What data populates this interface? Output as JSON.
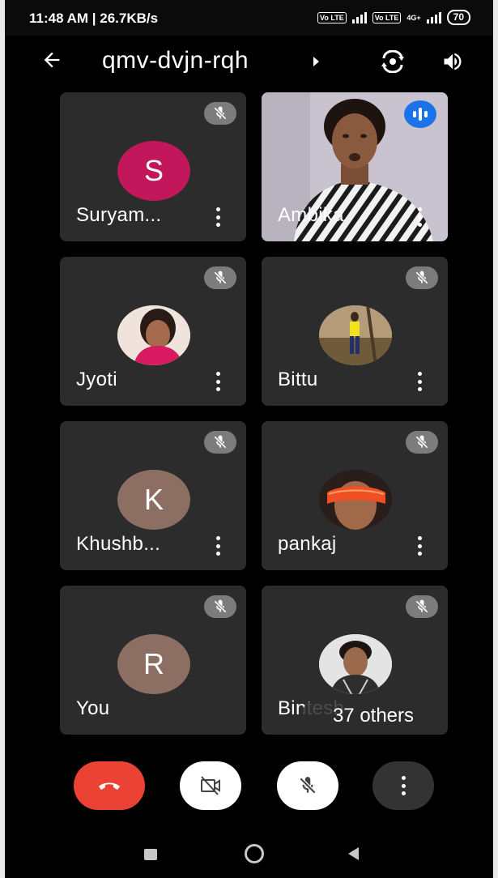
{
  "status_bar": {
    "time_speed": "11:48 AM | 26.7KB/s",
    "lte1": "Vo LTE",
    "lte2": "Vo LTE",
    "network": "4G+",
    "battery": "70"
  },
  "meeting": {
    "code": "qmv-dvjn-rqh"
  },
  "participants": [
    {
      "name": "Suryam...",
      "initial": "S",
      "avatar_color": "#c2185b"
    },
    {
      "name": "Ambika",
      "video": true,
      "speaking": true
    },
    {
      "name": "Jyoti",
      "photo": true
    },
    {
      "name": "Bittu",
      "photo": true
    },
    {
      "name": "Khushb...",
      "initial": "K",
      "avatar_color": "#8d6e63"
    },
    {
      "name": "pankaj",
      "photo": true
    },
    {
      "name": "You",
      "initial": "R",
      "avatar_color": "#8d6e63"
    },
    {
      "name": "Bintesh",
      "photo": true
    }
  ],
  "others_chip": "37 others",
  "controls": {
    "end_call_color": "#ea4335"
  },
  "icons": [
    "back-arrow-icon",
    "dropdown-caret-icon",
    "switch-camera-icon",
    "speaker-icon",
    "mic-off-icon",
    "more-vert-icon",
    "audio-level-icon",
    "end-call-icon",
    "camera-off-icon",
    "nav-recents-icon",
    "nav-home-icon",
    "nav-back-icon"
  ]
}
